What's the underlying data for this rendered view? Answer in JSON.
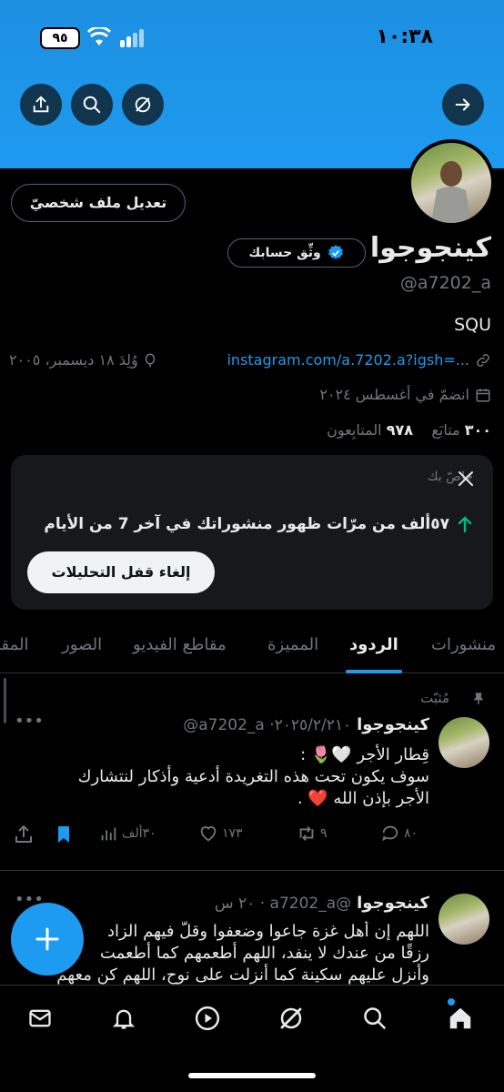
{
  "status": {
    "time": "١٠:٣٨",
    "battery": "٩٥"
  },
  "profile": {
    "name": "كينجوجوا",
    "handle": "@a7202_a",
    "bio": "SQU",
    "edit_button": "تعديل ملف شخصيّ",
    "verify_button": "وثِّق حسابك",
    "link": "instagram.com/a.7202.a?igsh=...",
    "birth": "وُلِدَ ١٨ ديسمبر، ٢٠٠٥",
    "joined": "انضمّ في أغسطس ٢٠٢٤",
    "following_count": "٣٠٠",
    "following_label": "متابَع",
    "followers_count": "٩٧٨",
    "followers_label": "المتابِعون"
  },
  "analytics_card": {
    "title": "خاصّ بك",
    "message": "٥٧ألف من مرّات ظهور منشوراتك في آخر 7 من الأيام",
    "button": "إلغاء قفل التحليلات"
  },
  "tabs": [
    "منشورات",
    "الردود",
    "المميزة",
    "مقاطع الفيديو",
    "الصور",
    "المقا"
  ],
  "tweets": [
    {
      "pinned_label": "مُثبّت",
      "name": "كينجوجوا",
      "handle_time": "@a7202_a ·٢٠٢٥/٢/٢١٠",
      "line1": "قِطار الأجر 🤍🌷 :",
      "line2": "سوف يكون تحت هذه التغريدة أدعية وأذكار لنتشارك",
      "line3": "الأجر بإذن الله ❤️ .",
      "replies": "٨٠",
      "retweets": "٩",
      "likes": "١٧٣",
      "views": "٣٠ألف"
    },
    {
      "name": "كينجوجوا",
      "handle_time": "@a7202_a · ٢٠ س",
      "line1": "اللهم إن أهل غزة جاعوا وضعفوا وقلّ فيهم الزاد",
      "line2": "رزقًا من عندك لا ينفد، اللهم أطعمهم كما أطعمت",
      "line3": "وأنزل عليهم سكينة كما أنزلت على نوح، اللهم كن معهم"
    }
  ],
  "colors": {
    "accent": "#1d9bf0",
    "background": "#000000",
    "muted": "#71767b"
  }
}
